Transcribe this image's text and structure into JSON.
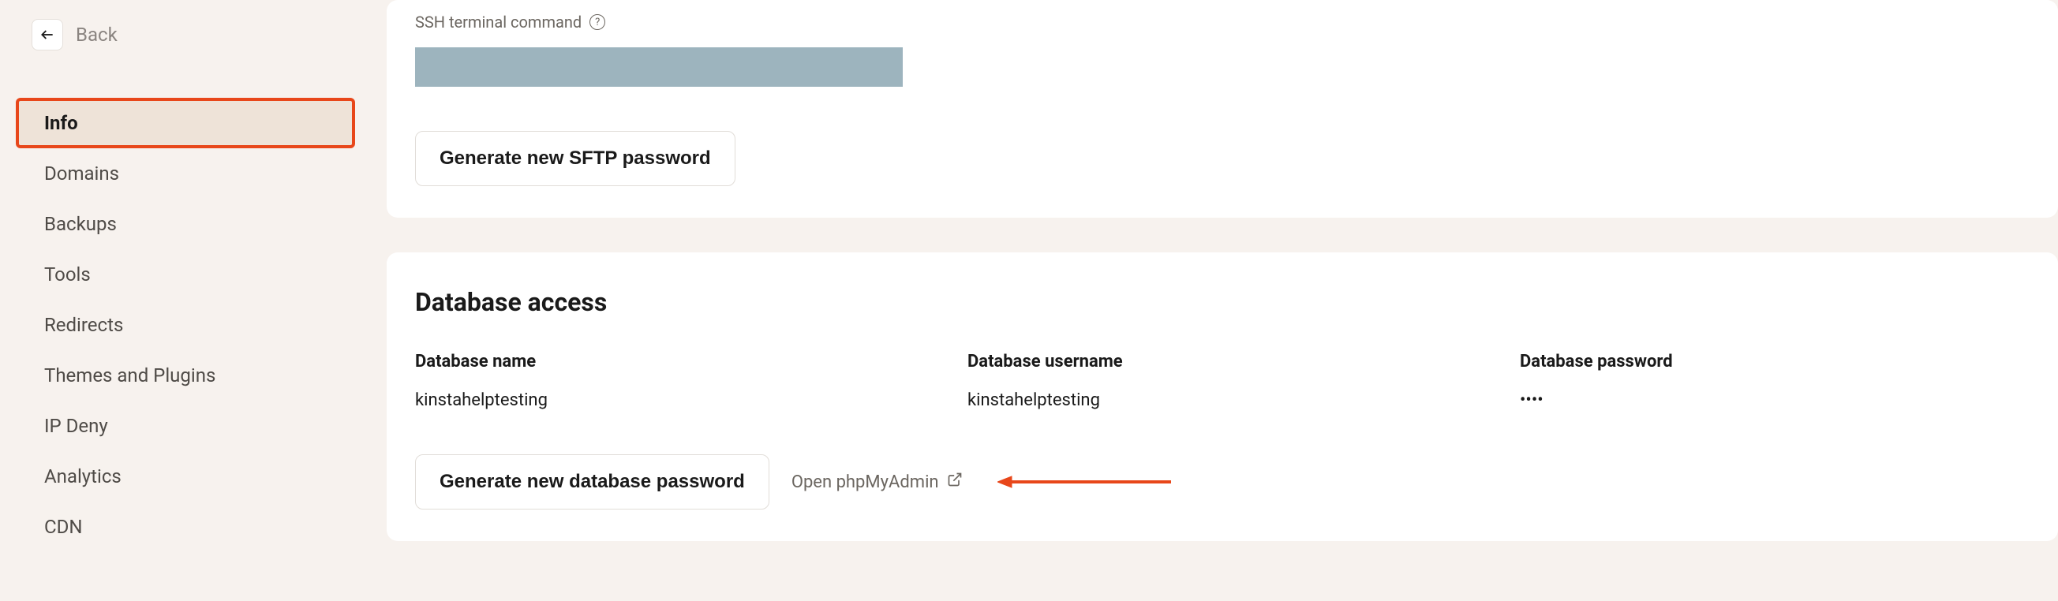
{
  "back": {
    "label": "Back"
  },
  "sidebar": {
    "items": [
      {
        "label": "Info",
        "active": true
      },
      {
        "label": "Domains",
        "active": false
      },
      {
        "label": "Backups",
        "active": false
      },
      {
        "label": "Tools",
        "active": false
      },
      {
        "label": "Redirects",
        "active": false
      },
      {
        "label": "Themes and Plugins",
        "active": false
      },
      {
        "label": "IP Deny",
        "active": false
      },
      {
        "label": "Analytics",
        "active": false
      },
      {
        "label": "CDN",
        "active": false
      }
    ]
  },
  "ssh": {
    "label": "SSH terminal command",
    "generate_button": "Generate new SFTP password"
  },
  "database": {
    "section_title": "Database access",
    "name_label": "Database name",
    "name_value": "kinstahelptesting",
    "username_label": "Database username",
    "username_value": "kinstahelptesting",
    "password_label": "Database password",
    "password_value": "••••",
    "generate_button": "Generate new database password",
    "open_link": "Open phpMyAdmin"
  }
}
